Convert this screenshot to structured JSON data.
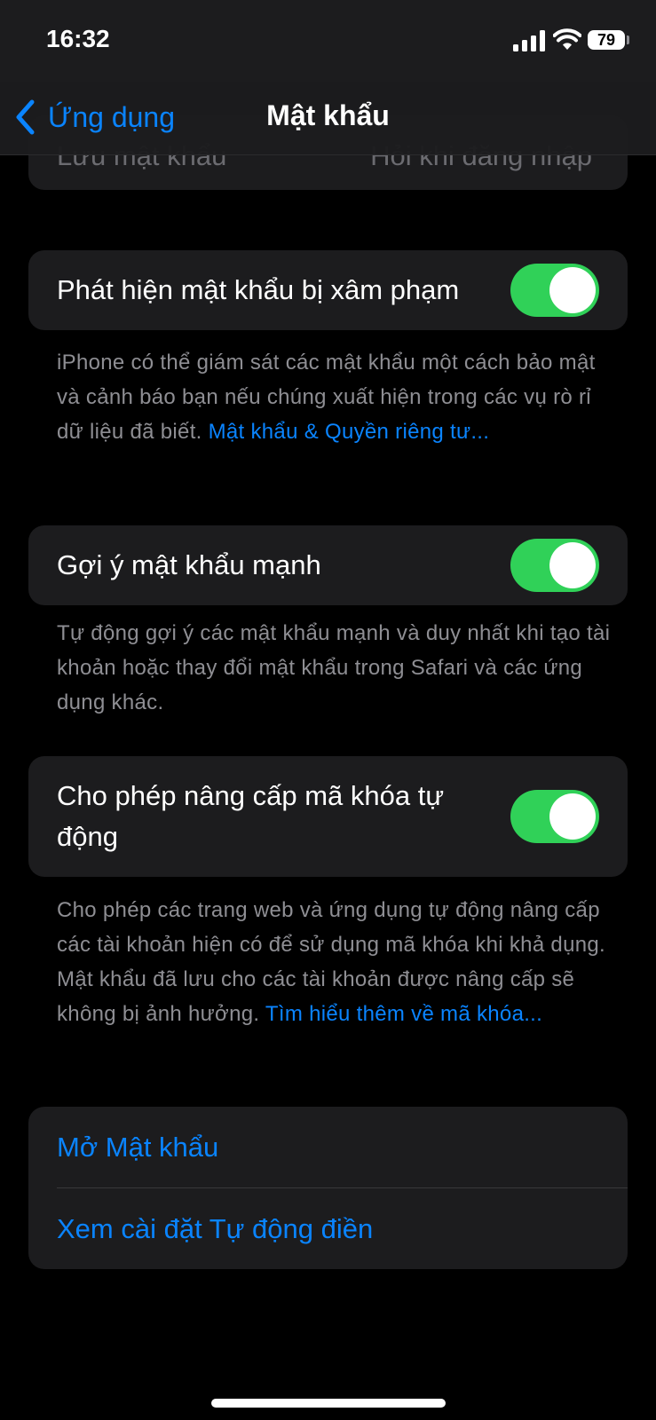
{
  "status": {
    "time": "16:32",
    "battery": "79"
  },
  "nav": {
    "back_label": "Ứng dụng",
    "title": "Mật khẩu"
  },
  "partial_row": {
    "label": "Lưu mật khẩu",
    "value": "Hỏi khi đăng nhập"
  },
  "settings": [
    {
      "label": "Phát hiện mật khẩu bị xâm phạm",
      "enabled": true,
      "footnote": "iPhone có thể giám sát các mật khẩu một cách bảo mật và cảnh báo bạn nếu chúng xuất hiện trong các vụ rò rỉ dữ liệu đã biết.",
      "footnote_link": "Mật khẩu & Quyền riêng tư..."
    },
    {
      "label": "Gợi ý mật khẩu mạnh",
      "enabled": true,
      "footnote": "Tự động gợi ý các mật khẩu mạnh và duy nhất khi tạo tài khoản hoặc thay đổi mật khẩu trong Safari và các ứng dụng khác."
    },
    {
      "label": "Cho phép nâng cấp mã khóa tự động",
      "enabled": true,
      "footnote": "Cho phép các trang web và ứng dụng tự động nâng cấp các tài khoản hiện có để sử dụng mã khóa khi khả dụng. Mật khẩu đã lưu cho các tài khoản được nâng cấp sẽ không bị ảnh hưởng.",
      "footnote_link": "Tìm hiểu thêm về mã khóa..."
    }
  ],
  "actions": {
    "open_passwords": "Mở Mật khẩu",
    "autofill_settings": "Xem cài đặt Tự động điền"
  },
  "colors": {
    "accent": "#0a84ff",
    "toggle_on": "#30d158",
    "cell": "#1c1c1e"
  }
}
